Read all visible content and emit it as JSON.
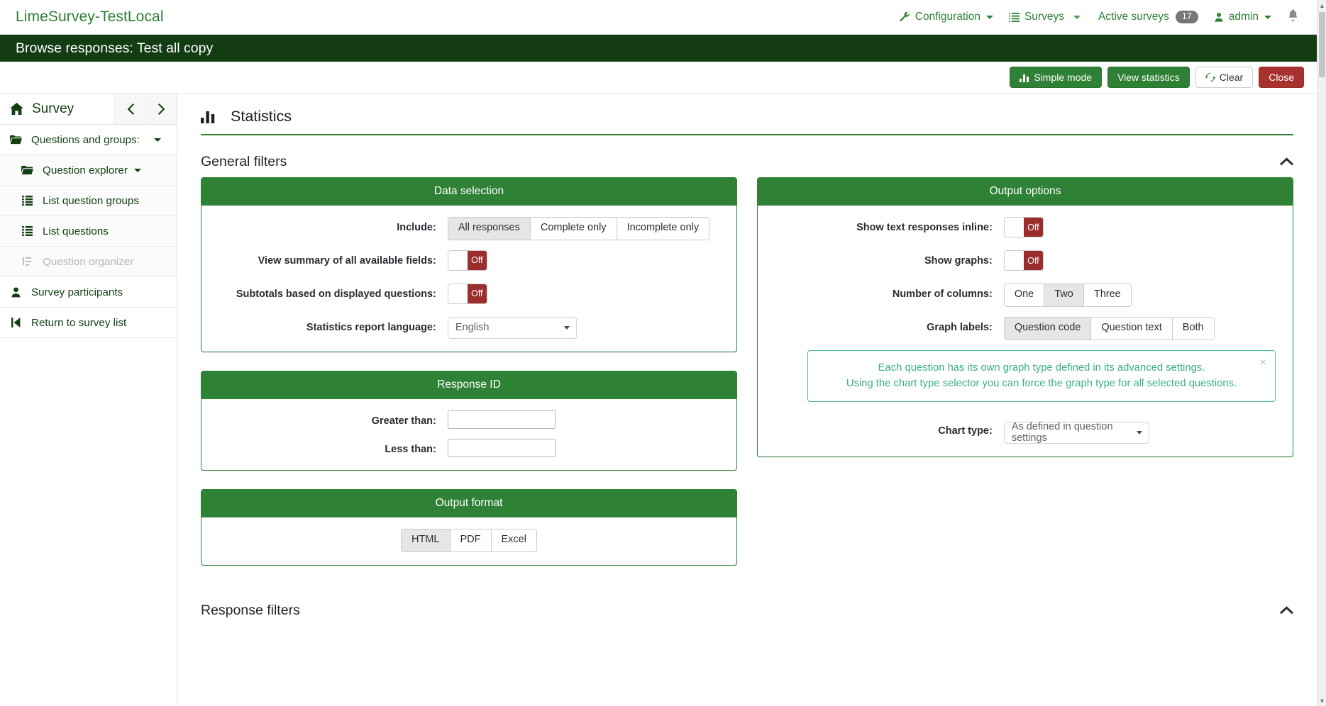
{
  "navbar": {
    "brand": "LimeSurvey-TestLocal",
    "items": [
      {
        "label": "Configuration",
        "icon": "wrench-icon",
        "caret": true
      },
      {
        "label": "Surveys",
        "icon": "list-icon",
        "caret": true
      },
      {
        "label": "Active surveys",
        "icon": "",
        "badge": "17"
      },
      {
        "label": "admin",
        "icon": "user-icon",
        "caret": true
      }
    ],
    "bell_icon": "bell-icon"
  },
  "title_bar": {
    "title": "Browse responses: Test all copy"
  },
  "action_buttons": [
    {
      "label": "Simple mode",
      "icon": "bar-chart-icon",
      "style": "green"
    },
    {
      "label": "View statistics",
      "icon": "",
      "style": "green-outline"
    },
    {
      "label": "Clear",
      "icon": "refresh-icon",
      "style": "white"
    },
    {
      "label": "Close",
      "icon": "",
      "style": "red"
    }
  ],
  "sidebar": {
    "header": {
      "label": "Survey",
      "icon": "home-icon",
      "prev_icon": "chevron-left-icon",
      "next_icon": "chevron-right-icon"
    },
    "items": [
      {
        "label": "Questions and groups:",
        "icon": "folder-open-icon",
        "level": 1,
        "caret": true,
        "disabled": false
      },
      {
        "label": "Question explorer",
        "icon": "folder-open-icon",
        "level": 2,
        "inline_caret": true,
        "disabled": false
      },
      {
        "label": "List question groups",
        "icon": "list-ul-icon",
        "level": 2,
        "disabled": false
      },
      {
        "label": "List questions",
        "icon": "list-ul-icon",
        "level": 2,
        "disabled": false
      },
      {
        "label": "Question organizer",
        "icon": "organize-icon",
        "level": 2,
        "disabled": true
      },
      {
        "label": "Survey participants",
        "icon": "user-icon",
        "level": 1,
        "disabled": false
      },
      {
        "label": "Return to survey list",
        "icon": "step-backward-icon",
        "level": 1,
        "disabled": false
      }
    ]
  },
  "main": {
    "page_title": "Statistics",
    "page_title_icon": "bar-chart-icon",
    "sections": {
      "general_filters": {
        "title": "General filters",
        "collapse_icon": "chevron-up-icon"
      },
      "response_filters": {
        "title": "Response filters",
        "collapse_icon": "chevron-up-icon"
      }
    },
    "data_selection": {
      "title": "Data selection",
      "include": {
        "label": "Include:",
        "options": [
          "All responses",
          "Complete only",
          "Incomplete only"
        ],
        "selected": "All responses"
      },
      "view_summary": {
        "label": "View summary of all available fields:",
        "value": "Off"
      },
      "subtotals": {
        "label": "Subtotals based on displayed questions:",
        "value": "Off"
      },
      "report_language": {
        "label": "Statistics report language:",
        "value": "English"
      }
    },
    "response_id": {
      "title": "Response ID",
      "greater_than": {
        "label": "Greater than:",
        "value": "",
        "placeholder": ""
      },
      "less_than": {
        "label": "Less than:",
        "value": "",
        "placeholder": ""
      }
    },
    "output_format": {
      "title": "Output format",
      "options": [
        "HTML",
        "PDF",
        "Excel"
      ],
      "selected": "HTML"
    },
    "output_options": {
      "title": "Output options",
      "show_text_inline": {
        "label": "Show text responses inline:",
        "value": "Off"
      },
      "show_graphs": {
        "label": "Show graphs:",
        "value": "Off"
      },
      "number_of_columns": {
        "label": "Number of columns:",
        "options": [
          "One",
          "Two",
          "Three"
        ],
        "selected": "Two"
      },
      "graph_labels": {
        "label": "Graph labels:",
        "options": [
          "Question code",
          "Question text",
          "Both"
        ],
        "selected": "Question code"
      },
      "alert": {
        "line1": "Each question has its own graph type defined in its advanced settings.",
        "line2": "Using the chart type selector you can force the graph type for all selected questions.",
        "close_label": "×"
      },
      "chart_type": {
        "label": "Chart type:",
        "value": "As defined in question settings"
      }
    }
  },
  "colors": {
    "brand_green": "#2f8136",
    "dark_green": "#133c13",
    "danger_red": "#a8312f",
    "toggle_off_red": "#9b2d2c",
    "alert_green": "#3ab07d"
  }
}
